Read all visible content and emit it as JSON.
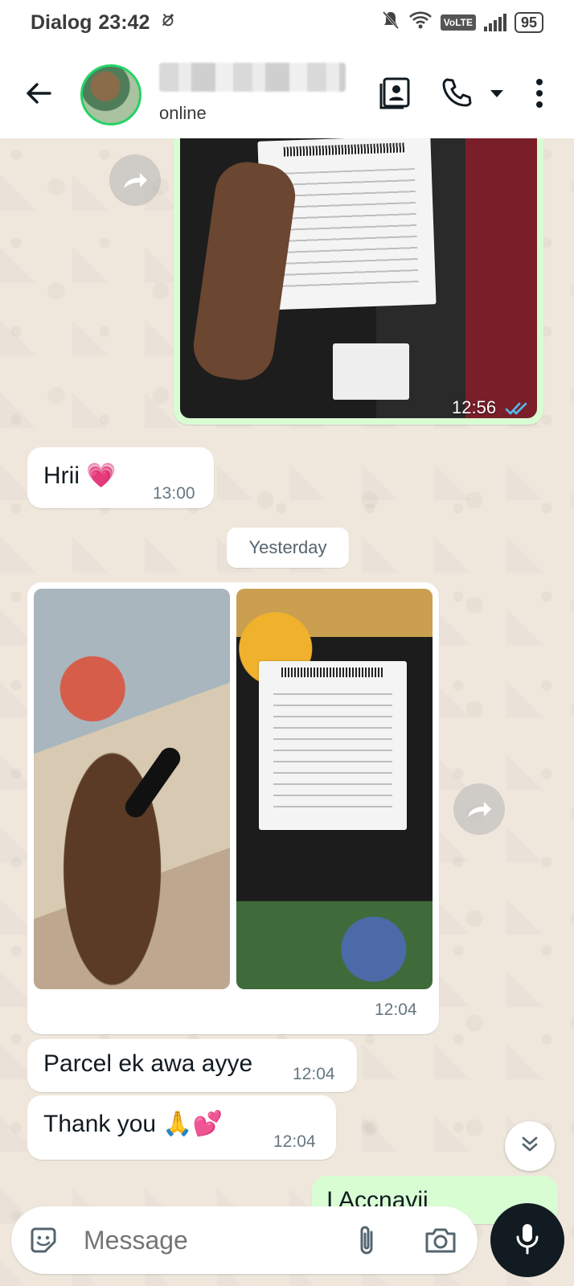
{
  "status_bar": {
    "carrier": "Dialog",
    "time": "23:42",
    "volte": "VoLTE",
    "battery": "95"
  },
  "header": {
    "status": "online"
  },
  "messages": [
    {
      "kind": "image-out",
      "time": "12:56"
    },
    {
      "kind": "text-in",
      "text": "Hrii 💗",
      "time": "13:00"
    },
    {
      "kind": "date",
      "text": "Yesterday"
    },
    {
      "kind": "album-in",
      "time": "12:04"
    },
    {
      "kind": "text-in",
      "text": "Parcel ek awa ayye",
      "time": "12:04"
    },
    {
      "kind": "text-in",
      "text": "Thank you 🙏💕",
      "time": "12:04"
    },
    {
      "kind": "text-out-partial",
      "text": "I Accnavii"
    }
  ],
  "composer": {
    "placeholder": "Message"
  },
  "icons": [
    "back-arrow-icon",
    "contact-card-icon",
    "phone-icon",
    "caret-down-icon",
    "more-vert-icon",
    "forward-icon",
    "double-check-icon",
    "chevrons-down-icon",
    "sticker-icon",
    "paperclip-icon",
    "camera-icon",
    "mic-icon",
    "mute-icon",
    "wifi-icon",
    "signal-icon"
  ],
  "colors": {
    "outgoing_bubble": "#d9fdd3",
    "incoming_bubble": "#ffffff",
    "read_ticks": "#53bdeb",
    "accent_green": "#25d366"
  }
}
